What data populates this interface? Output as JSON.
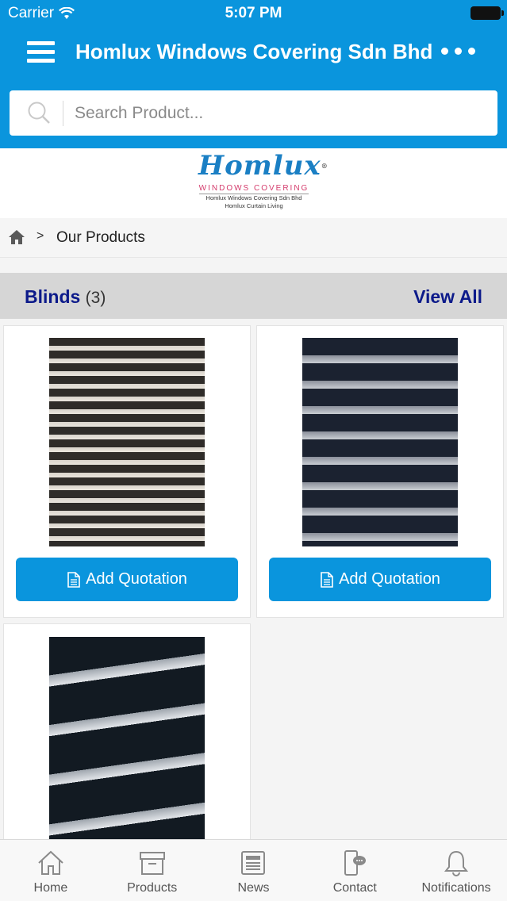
{
  "status_bar": {
    "carrier": "Carrier",
    "time": "5:07 PM"
  },
  "header": {
    "title": "Homlux Windows Covering Sdn Bhd"
  },
  "search": {
    "placeholder": "Search Product..."
  },
  "logo": {
    "brand": "Homlux",
    "tagline": "WINDOWS COVERING",
    "line1": "Homlux Windows Covering Sdn Bhd",
    "line2": "Homlux Curtain Living"
  },
  "breadcrumb": {
    "current": "Our Products"
  },
  "section": {
    "title": "Blinds",
    "count": "(3)",
    "view_all": "View All"
  },
  "products": [
    {
      "button_label": "Add Quotation"
    },
    {
      "button_label": "Add Quotation"
    },
    {
      "button_label": ""
    }
  ],
  "tabbar": {
    "items": [
      {
        "label": "Home",
        "icon": "home-icon"
      },
      {
        "label": "Products",
        "icon": "box-icon"
      },
      {
        "label": "News",
        "icon": "newspaper-icon"
      },
      {
        "label": "Contact",
        "icon": "phone-chat-icon"
      },
      {
        "label": "Notifications",
        "icon": "bell-icon"
      }
    ]
  },
  "colors": {
    "primary": "#0a95dd",
    "section_title": "#0c1a8a",
    "section_bg": "#d6d6d6"
  }
}
